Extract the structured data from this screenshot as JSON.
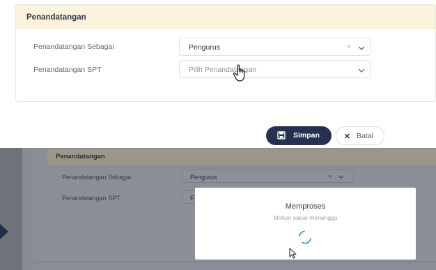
{
  "top_form": {
    "section_title": "Penandatangan",
    "rows": [
      {
        "label": "Penandatangan Sebagai",
        "value": "Pengurus",
        "clear_glyph": "×"
      },
      {
        "label": "Penandatangan SPT",
        "placeholder": "Pilih Penandatangan"
      }
    ],
    "save_label": "Simpan",
    "cancel_label": "Batal",
    "cancel_glyph": "✕"
  },
  "bottom_form": {
    "section_title": "Penandatangan",
    "rows": [
      {
        "label": "Penandatangan Sebagai",
        "value": "Pengurus",
        "clear_glyph": "×"
      },
      {
        "label": "Penandatangan SPT",
        "value_partial": "F"
      }
    ]
  },
  "loading_modal": {
    "title": "Memproses",
    "subtitle": "Mohon sabar menunggu"
  },
  "colors": {
    "header_band": "#fcf3dc",
    "primary_button": "#25314f",
    "spinner": "#3b82c4",
    "overlay": "#7d8089"
  },
  "icons": {
    "save": "save-icon",
    "cancel": "close-icon",
    "dropdown": "chevron-down-icon",
    "clear": "clear-icon",
    "pointer": "hand-pointer-icon",
    "mouse": "arrow-cursor-icon"
  }
}
